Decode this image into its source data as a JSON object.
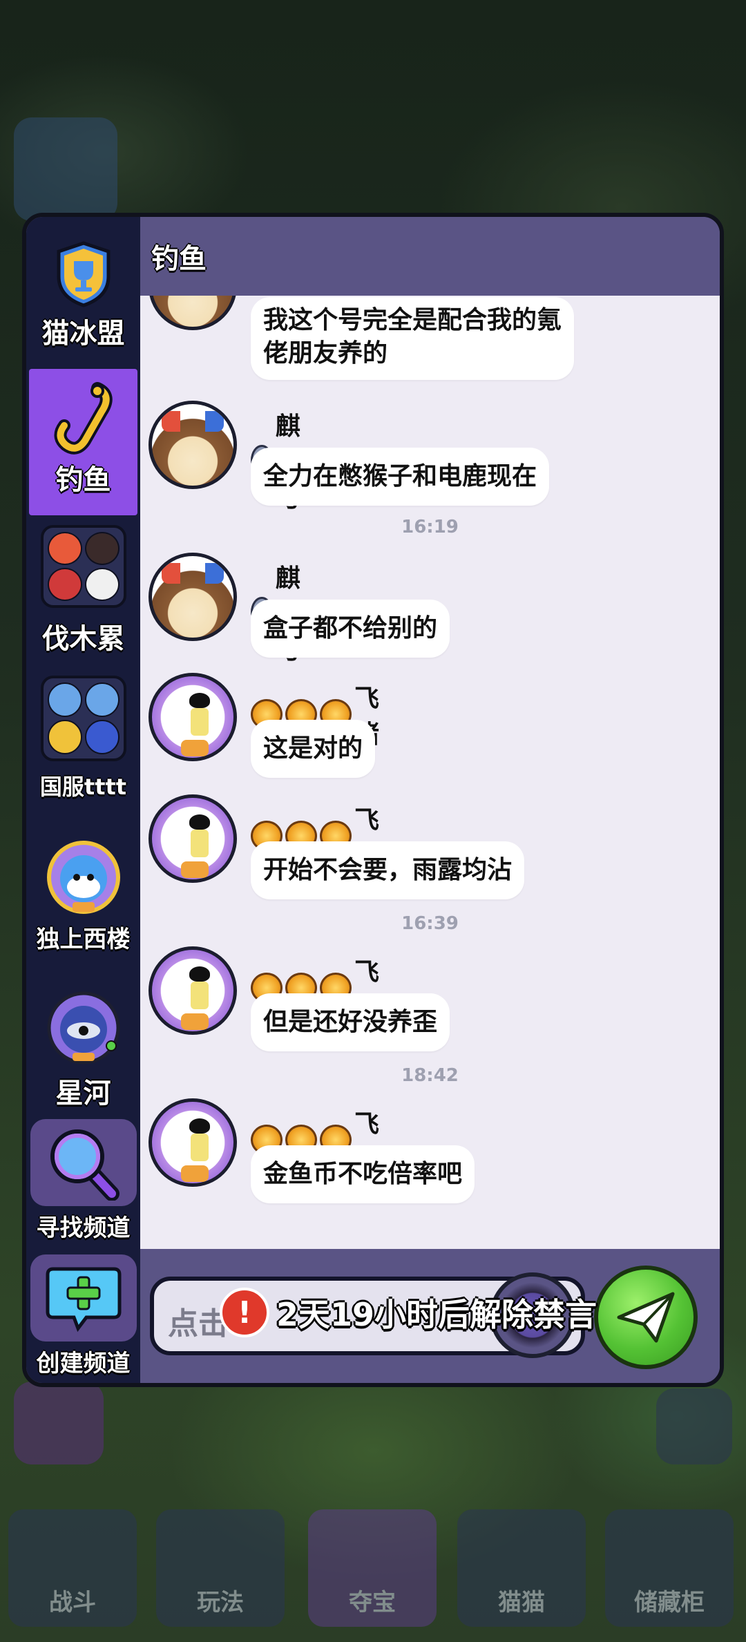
{
  "nav": {
    "tabs": [
      "战斗",
      "玩法",
      "夺宝",
      "猫猫",
      "储藏柜"
    ],
    "active_index": 2
  },
  "sidebar": {
    "items": [
      {
        "label": "猫冰盟",
        "icon": "trophy-shield-icon"
      },
      {
        "label": "钓鱼",
        "icon": "fishing-hook-icon",
        "active": true
      },
      {
        "label": "伐木累",
        "icon": "group-avatars-icon"
      },
      {
        "label": "国服tttt",
        "icon": "group-avatars-icon"
      },
      {
        "label": "独上西楼",
        "icon": "cat-avatar-icon"
      },
      {
        "label": "星河",
        "icon": "helmet-avatar-icon"
      },
      {
        "label": "寻找频道",
        "icon": "magnifier-icon"
      },
      {
        "label": "创建频道",
        "icon": "plus-icon"
      }
    ]
  },
  "header": {
    "title": "钓鱼"
  },
  "messages": [
    {
      "sender": "",
      "avatar": "dog",
      "text_lines": [
        "我这个号完全是配合我的氪",
        "佬朋友养的"
      ]
    },
    {
      "sender": "麒麟弓",
      "avatar": "dog",
      "text": "全力在憋猴子和电鹿现在"
    },
    {
      "time": "16:19"
    },
    {
      "sender": "麒麟弓",
      "avatar": "dog",
      "text": "盒子都不给别的"
    },
    {
      "sender": "飞猪",
      "avatar": "girl",
      "text": "这是对的"
    },
    {
      "sender": "飞猪",
      "avatar": "girl",
      "text": "开始不会要，雨露均沾"
    },
    {
      "time": "16:39"
    },
    {
      "sender": "飞猪",
      "avatar": "girl",
      "text": "但是还好没养歪"
    },
    {
      "time": "18:42"
    },
    {
      "sender": "飞猪",
      "avatar": "girl",
      "text": "金鱼币不吃倍率吧"
    }
  ],
  "input": {
    "placeholder": "点击",
    "ban_notice": "2天19小时后解除禁言"
  },
  "colors": {
    "panel": "#5a5485",
    "sidebar": "#171b3a",
    "active": "#8d4fe6",
    "chat_bg": "#eeebf4",
    "send": "#54c234"
  }
}
